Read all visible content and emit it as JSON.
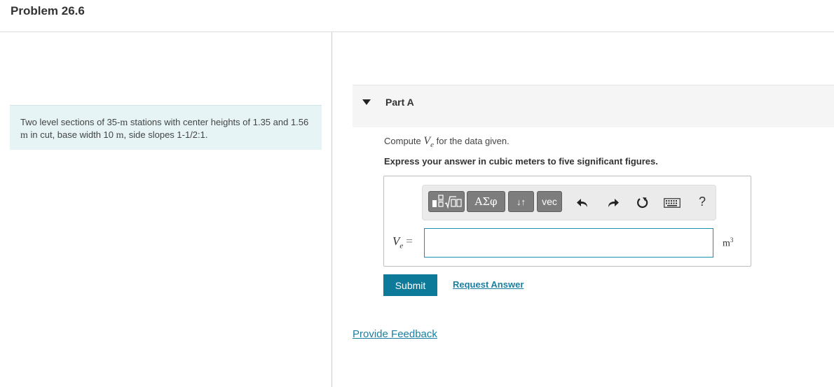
{
  "header": {
    "title": "Problem 26.6"
  },
  "problem": {
    "text_1": "Two level sections of 35-",
    "unit_m_1": "m",
    "text_2": " stations with center heights of 1.35 and 1.56 ",
    "unit_m_2": "m",
    "text_3": " in cut, base width 10 ",
    "unit_m_3": "m",
    "text_4": ", side slopes 1-1/2:1."
  },
  "part": {
    "label": "Part A",
    "prompt_before": "Compute ",
    "prompt_var": "V",
    "prompt_sub": "e",
    "prompt_after": " for the data given.",
    "instruction": "Express your answer in cubic meters to five significant figures."
  },
  "toolbar": {
    "greek_label": "ΑΣφ",
    "arrows_label": "↓↑",
    "vec_label": "vec",
    "help_label": "?"
  },
  "answer": {
    "var": "V",
    "sub": "e",
    "equals": "=",
    "value": "",
    "unit": "m",
    "unit_exp": "3"
  },
  "actions": {
    "submit_label": "Submit",
    "request_answer_label": "Request Answer",
    "feedback_label": "Provide Feedback"
  },
  "colors": {
    "accent": "#0d7a9a",
    "link": "#1a7fa0",
    "problem_bg": "#e6f4f6",
    "toolbar_button": "#7d7d7d"
  },
  "icons": {
    "templates": "fraction-sqrt-icon",
    "undo": "undo-icon",
    "redo": "redo-icon",
    "reset": "reset-icon",
    "keyboard": "keyboard-icon"
  }
}
